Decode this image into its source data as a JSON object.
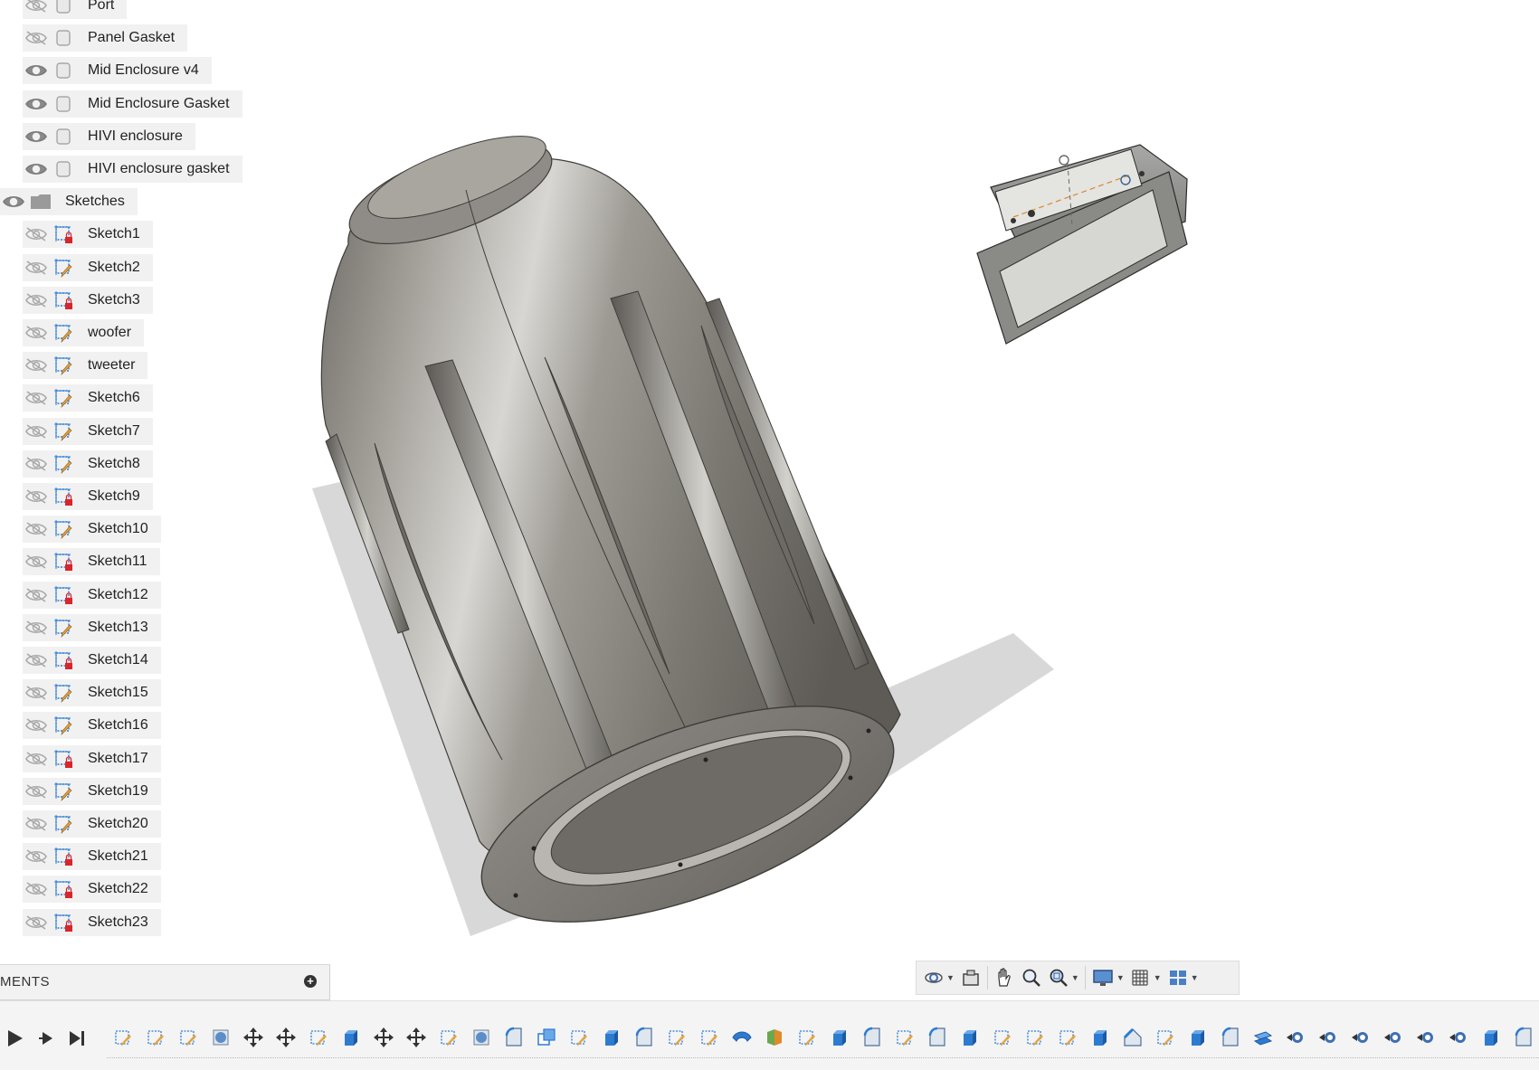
{
  "browser": {
    "rows": [
      {
        "label": "Port",
        "eye": "hidden-eye",
        "type": "body"
      },
      {
        "label": "Panel Gasket",
        "eye": "hidden-eye",
        "type": "body"
      },
      {
        "label": "Mid Enclosure v4",
        "eye": "eye",
        "type": "body"
      },
      {
        "label": "Mid Enclosure Gasket",
        "eye": "eye",
        "type": "body"
      },
      {
        "label": "HIVI enclosure",
        "eye": "eye",
        "type": "body"
      },
      {
        "label": "HIVI enclosure gasket",
        "eye": "eye",
        "type": "body"
      },
      {
        "label": "Sketches",
        "eye": "eye",
        "type": "folder"
      },
      {
        "label": "Sketch1",
        "eye": "hidden-eye",
        "type": "sketch-locked"
      },
      {
        "label": "Sketch2",
        "eye": "hidden-eye",
        "type": "sketch"
      },
      {
        "label": "Sketch3",
        "eye": "hidden-eye",
        "type": "sketch-locked"
      },
      {
        "label": "woofer",
        "eye": "hidden-eye",
        "type": "sketch"
      },
      {
        "label": "tweeter",
        "eye": "hidden-eye",
        "type": "sketch"
      },
      {
        "label": "Sketch6",
        "eye": "hidden-eye",
        "type": "sketch"
      },
      {
        "label": "Sketch7",
        "eye": "hidden-eye",
        "type": "sketch"
      },
      {
        "label": "Sketch8",
        "eye": "hidden-eye",
        "type": "sketch"
      },
      {
        "label": "Sketch9",
        "eye": "hidden-eye",
        "type": "sketch-locked"
      },
      {
        "label": "Sketch10",
        "eye": "hidden-eye",
        "type": "sketch"
      },
      {
        "label": "Sketch11",
        "eye": "hidden-eye",
        "type": "sketch-locked"
      },
      {
        "label": "Sketch12",
        "eye": "hidden-eye",
        "type": "sketch-locked"
      },
      {
        "label": "Sketch13",
        "eye": "hidden-eye",
        "type": "sketch"
      },
      {
        "label": "Sketch14",
        "eye": "hidden-eye",
        "type": "sketch-locked"
      },
      {
        "label": "Sketch15",
        "eye": "hidden-eye",
        "type": "sketch"
      },
      {
        "label": "Sketch16",
        "eye": "hidden-eye",
        "type": "sketch"
      },
      {
        "label": "Sketch17",
        "eye": "hidden-eye",
        "type": "sketch-locked"
      },
      {
        "label": "Sketch19",
        "eye": "hidden-eye",
        "type": "sketch"
      },
      {
        "label": "Sketch20",
        "eye": "hidden-eye",
        "type": "sketch"
      },
      {
        "label": "Sketch21",
        "eye": "hidden-eye",
        "type": "sketch-locked"
      },
      {
        "label": "Sketch22",
        "eye": "hidden-eye",
        "type": "sketch-locked"
      },
      {
        "label": "Sketch23",
        "eye": "hidden-eye",
        "type": "sketch-locked"
      }
    ]
  },
  "comments": {
    "title": "MENTS",
    "add_icon": "plus-circle-icon"
  },
  "navbar": {
    "buttons": [
      "orbit-icon",
      "look-at-icon",
      "pan-icon",
      "zoom-icon",
      "fit-icon",
      "display-settings-icon",
      "grid-settings-icon",
      "viewports-icon"
    ]
  },
  "timeline": {
    "controls": [
      "play-icon",
      "step-forward-icon",
      "go-to-end-icon"
    ],
    "features": [
      "sketch",
      "sketch",
      "sketch",
      "revolve",
      "move",
      "move",
      "sketch",
      "extrude",
      "move",
      "move",
      "sketch",
      "revolve",
      "fillet",
      "combine",
      "sketch",
      "extrude",
      "fillet",
      "sketch",
      "sketch",
      "shell",
      "split",
      "sketch",
      "extrude",
      "fillet",
      "sketch",
      "fillet",
      "extrude",
      "sketch",
      "sketch",
      "sketch",
      "extrude",
      "chamfer",
      "sketch",
      "extrude",
      "fillet",
      "offset",
      "joint",
      "joint",
      "joint",
      "joint",
      "joint",
      "joint",
      "extrude",
      "fillet"
    ]
  },
  "colors": {
    "panel_bg": "#f1f1f1",
    "sketch_blue": "#2b7cd3",
    "lock_red": "#d8262b",
    "pencil_orange": "#e9a23b",
    "model_gray": "#8a8782"
  }
}
